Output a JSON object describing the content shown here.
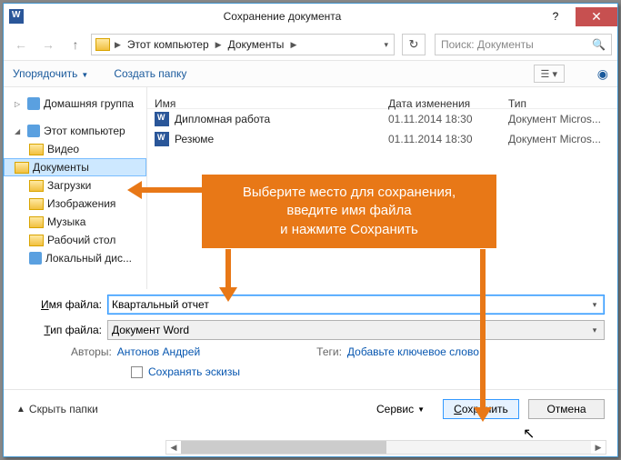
{
  "title": "Сохранение документа",
  "path": {
    "seg1": "Этот компьютер",
    "seg2": "Документы"
  },
  "search_placeholder": "Поиск: Документы",
  "toolbar": {
    "organize": "Упорядочить",
    "new_folder": "Создать папку"
  },
  "sidebar": {
    "homegroup": "Домашняя группа",
    "pc": "Этот компьютер",
    "items": [
      "Видео",
      "Документы",
      "Загрузки",
      "Изображения",
      "Музыка",
      "Рабочий стол",
      "Локальный дис..."
    ]
  },
  "columns": {
    "name": "Имя",
    "date": "Дата изменения",
    "type": "Тип"
  },
  "files": [
    {
      "name": "Дипломная работа",
      "date": "01.11.2014 18:30",
      "type": "Документ Micros..."
    },
    {
      "name": "Резюме",
      "date": "01.11.2014 18:30",
      "type": "Документ Micros..."
    }
  ],
  "form": {
    "name_label": "Имя файла:",
    "name_value": "Квартальный отчет",
    "type_label": "Тип файла:",
    "type_value": "Документ Word",
    "authors_label": "Авторы:",
    "authors_value": "Антонов Андрей",
    "tags_label": "Теги:",
    "tags_value": "Добавьте ключевое слово",
    "thumb": "Сохранять эскизы"
  },
  "footer": {
    "hide": "Скрыть папки",
    "service": "Сервис",
    "save": "Сохранить",
    "cancel": "Отмена"
  },
  "callout": {
    "l1": "Выберите место для сохранения,",
    "l2": "введите имя файла",
    "l3": "и нажмите Сохранить"
  }
}
